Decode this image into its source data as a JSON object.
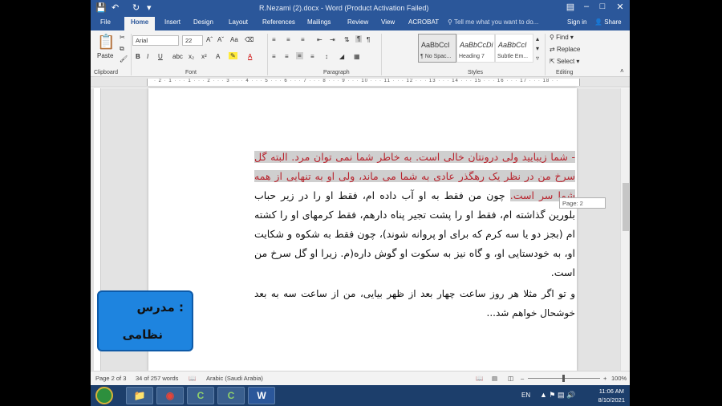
{
  "window": {
    "title": "R.Nezami (2).docx - Word (Product Activation Failed)"
  },
  "tabs": [
    "File",
    "Home",
    "Insert",
    "Design",
    "Layout",
    "References",
    "Mailings",
    "Review",
    "View",
    "ACROBAT"
  ],
  "tell_me": "Tell me what you want to do...",
  "account": {
    "signin": "Sign in",
    "share": "Share"
  },
  "ribbon": {
    "clipboard": {
      "label": "Clipboard",
      "paste": "Paste"
    },
    "font": {
      "label": "Font",
      "name": "Arial",
      "size": "22"
    },
    "paragraph": {
      "label": "Paragraph"
    },
    "styles": {
      "label": "Styles",
      "items": [
        {
          "sample": "AaBbCcI",
          "name": "¶ No Spac..."
        },
        {
          "sample": "AaBbCcDi",
          "name": "Heading 7"
        },
        {
          "sample": "AaBbCcI",
          "name": "Subtle Em..."
        }
      ]
    },
    "editing": {
      "label": "Editing",
      "find": "Find",
      "replace": "Replace",
      "select": "Select"
    }
  },
  "document": {
    "paragraph1_highlight": "- شما زیبایید ولی درونتان خالی است. به خاطر شما نمی توان مرد. البته گل سرخ من در نظر یک رهگذر عادی به شما می ماند، ولی او به تنهایی از همه شما سر است.",
    "paragraph1_rest": " چون من فقط به او آب داده ام، فقط او را در زیر حباب بلورین گذاشته ام، فقط او را پشت تجیر پناه دارهم، فقط کرمهای او را کشته ام (بجز دو یا سه کرم که برای او پروانه شوند)، چون فقط به شکوه و شکایت او، به خودستایی او، و گاه نیز به سکوت او گوش داره(م. زیرا او گل سرخ من است.",
    "paragraph2": "و تو اگر مثلا هر روز ساعت چهار بعد از ظهر بیایی، من از ساعت سه به بعد خوشحال خواهم شد..."
  },
  "page_tip": "Page: 2",
  "status": {
    "page": "Page 2 of 3",
    "words": "34 of 257 words",
    "language": "Arabic (Saudi Arabia)",
    "zoom": "100%"
  },
  "taskbar": {
    "lang": "EN",
    "time": "11:06 AM",
    "date": "8/10/2021"
  },
  "overlay": {
    "line1": "مدرس :",
    "line2": "نظامی"
  }
}
